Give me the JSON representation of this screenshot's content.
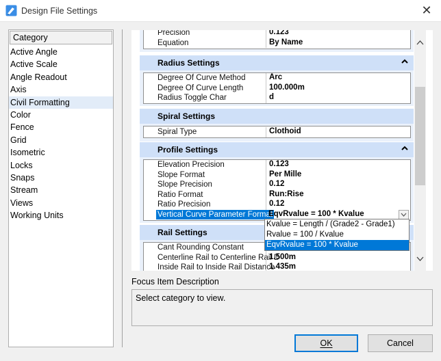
{
  "window": {
    "title": "Design File Settings",
    "close_glyph": "✕"
  },
  "category": {
    "header": "Category",
    "items": [
      "Active Angle",
      "Active Scale",
      "Angle Readout",
      "Axis",
      "Civil Formatting",
      "Color",
      "Fence",
      "Grid",
      "Isometric",
      "Locks",
      "Snaps",
      "Stream",
      "Views",
      "Working Units"
    ],
    "selected": "Civil Formatting"
  },
  "top_rows": [
    {
      "name": "Precision",
      "value": "0.123"
    },
    {
      "name": "Equation",
      "value": "By Name"
    }
  ],
  "sections": {
    "radius": {
      "title": "Radius Settings",
      "rows": [
        {
          "name": "Degree Of Curve Method",
          "value": "Arc"
        },
        {
          "name": "Degree Of Curve Length",
          "value": "100.000m"
        },
        {
          "name": "Radius Toggle Char",
          "value": "d"
        }
      ]
    },
    "spiral": {
      "title": "Spiral Settings",
      "rows": [
        {
          "name": "Spiral Type",
          "value": "Clothoid"
        }
      ]
    },
    "profile": {
      "title": "Profile Settings",
      "rows": [
        {
          "name": "Elevation Precision",
          "value": "0.123"
        },
        {
          "name": "Slope Format",
          "value": "Per Mille"
        },
        {
          "name": "Slope Precision",
          "value": "0.12"
        },
        {
          "name": "Ratio Format",
          "value": "Run:Rise"
        },
        {
          "name": "Ratio Precision",
          "value": "0.12"
        },
        {
          "name": "Vertical Curve Parameter Format",
          "value": "EqvRvalue = 100 * Kvalue"
        }
      ]
    },
    "rail": {
      "title": "Rail Settings",
      "rows": [
        {
          "name": "Cant Rounding Constant",
          "value": ""
        },
        {
          "name": "Centerline Rail to Centerline Rail D",
          "value": "1.500m"
        },
        {
          "name": "Inside Rail to Inside Rail Distance",
          "value": "1.435m"
        }
      ]
    }
  },
  "dropdown": {
    "options": [
      "Kvalue = Length / (Grade2 - Grade1)",
      "Rvalue = 100 / Kvalue",
      "EqvRvalue = 100 * Kvalue"
    ],
    "selected_index": 2
  },
  "focus": {
    "label": "Focus Item Description",
    "text": "Select category to view."
  },
  "buttons": {
    "ok": "OK",
    "cancel": "Cancel"
  },
  "colors": {
    "accent": "#0078d7",
    "section_header": "#cfe0f8",
    "selected_category": "#e2ecf8"
  }
}
